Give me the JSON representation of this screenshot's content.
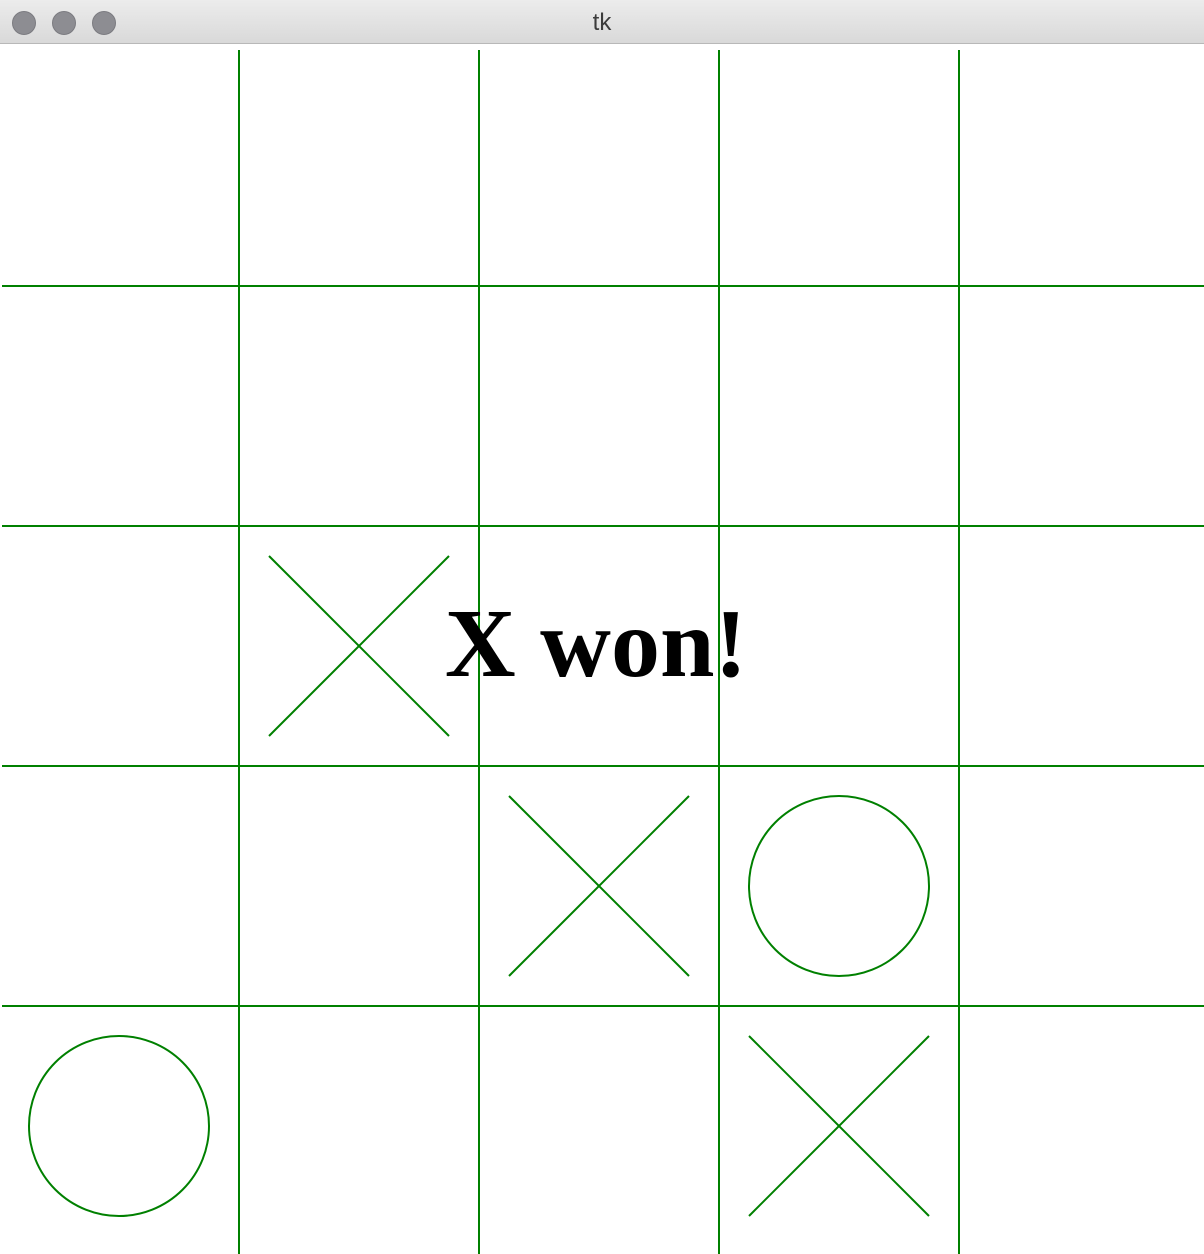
{
  "window": {
    "title": "tk"
  },
  "game": {
    "grid_size": 5,
    "line_color": "#008000",
    "board": [
      [
        "",
        "",
        "",
        "",
        ""
      ],
      [
        "",
        "",
        "",
        "",
        ""
      ],
      [
        "",
        "X",
        "",
        "",
        ""
      ],
      [
        "",
        "",
        "X",
        "O",
        ""
      ],
      [
        "O",
        "",
        "",
        "X",
        ""
      ]
    ],
    "status_text": "X won!",
    "status_color": "#000000"
  }
}
